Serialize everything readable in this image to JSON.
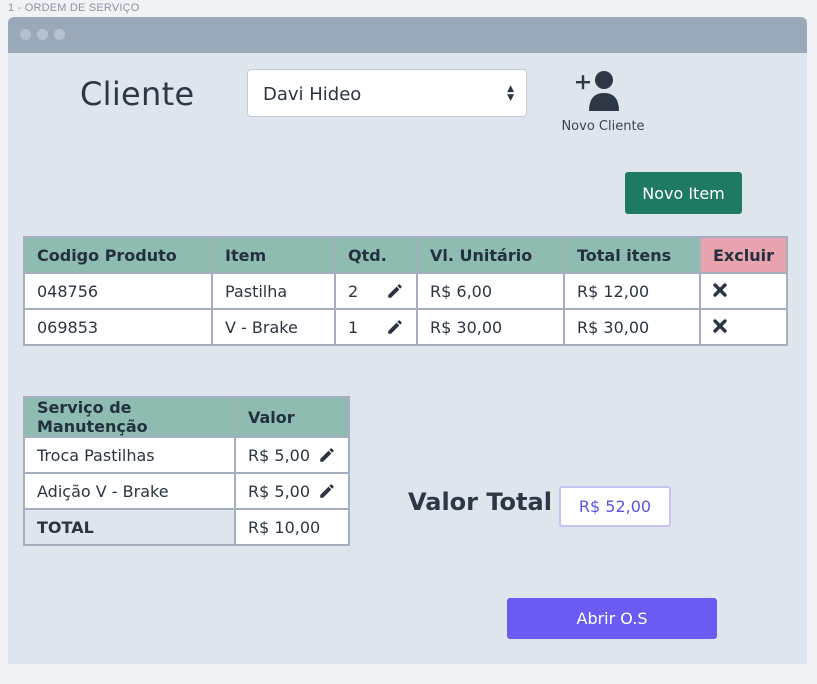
{
  "frame_label": "1 - ORDEM DE SERVIÇO",
  "client": {
    "label": "Cliente",
    "selected": "Davi Hideo",
    "new_client_label": "Novo Cliente"
  },
  "new_item_button": "Novo Item",
  "items_table": {
    "headers": [
      "Codigo Produto",
      "Item",
      "Qtd.",
      "Vl. Unitário",
      "Total itens",
      "Excluir"
    ],
    "rows": [
      {
        "code": "048756",
        "item": "Pastilha",
        "qty": "2",
        "unit_value": "R$ 6,00",
        "total": "R$ 12,00"
      },
      {
        "code": "069853",
        "item": "V - Brake",
        "qty": "1",
        "unit_value": "R$ 30,00",
        "total": "R$ 30,00"
      }
    ]
  },
  "services_table": {
    "headers": [
      "Serviço de Manutenção",
      "Valor"
    ],
    "rows": [
      {
        "service": "Troca Pastilhas",
        "value": "R$ 5,00"
      },
      {
        "service": "Adição V - Brake",
        "value": "R$ 5,00"
      }
    ],
    "total_label": "TOTAL",
    "total_value": "R$ 10,00"
  },
  "valor_total": {
    "label": "Valor Total",
    "value": "R$ 52,00"
  },
  "open_button": "Abrir O.S",
  "icons": {
    "edit": "pencil-icon",
    "delete": "close-icon",
    "add_user": "add-user-icon",
    "select": "chevron-updown-icon"
  },
  "colors": {
    "primary_green": "#1f7a63",
    "accent_purple": "#6a5cf2",
    "header_green": "#8ebcb0",
    "header_red": "#e8a3ae"
  }
}
